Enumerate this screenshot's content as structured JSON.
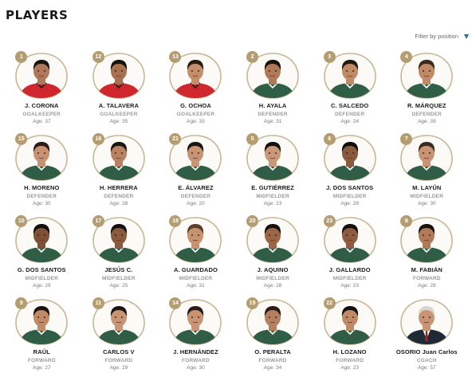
{
  "page": {
    "title": "Players"
  },
  "filter": {
    "label": "Filter by position"
  },
  "age_label": "Age:",
  "colors": {
    "frame_gold": "#c7b795",
    "badge_gold": "#b59d72",
    "jersey_green": "#2f5d46",
    "filter_caret": "#2c6aa5"
  },
  "players": [
    {
      "number": "1",
      "name": "J. CORONA",
      "position": "GOALKEEPER",
      "age": "37",
      "jersey": "#d0262e",
      "skin": "#b0785a",
      "hair": "#1b1410"
    },
    {
      "number": "12",
      "name": "A. TALAVERA",
      "position": "GOALKEEPER",
      "age": "35",
      "jersey": "#d0262e",
      "skin": "#a8704f",
      "hair": "#161210"
    },
    {
      "number": "13",
      "name": "G. OCHOA",
      "position": "GOALKEEPER",
      "age": "33",
      "jersey": "#d0262e",
      "skin": "#c58e6a",
      "hair": "#2a1a12"
    },
    {
      "number": "2",
      "name": "H. AYALA",
      "position": "DEFENDER",
      "age": "31",
      "jersey": "#2f5d46",
      "skin": "#b07a58",
      "hair": "#161210"
    },
    {
      "number": "3",
      "name": "C. SALCEDO",
      "position": "DEFENDER",
      "age": "24",
      "jersey": "#2f5d46",
      "skin": "#c08a66",
      "hair": "#231710"
    },
    {
      "number": "4",
      "name": "R. MÁRQUEZ",
      "position": "DEFENDER",
      "age": "39",
      "jersey": "#2f5d46",
      "skin": "#c08a66",
      "hair": "#3b2a20"
    },
    {
      "number": "15",
      "name": "H. MORENO",
      "position": "DEFENDER",
      "age": "30",
      "jersey": "#2f5d46",
      "skin": "#c69272",
      "hair": "#2a1c14"
    },
    {
      "number": "16",
      "name": "H. HERRERA",
      "position": "DEFENDER",
      "age": "28",
      "jersey": "#2f5d46",
      "skin": "#b98262",
      "hair": "#1e1510"
    },
    {
      "number": "21",
      "name": "E. ÁLVAREZ",
      "position": "DEFENDER",
      "age": "20",
      "jersey": "#2f5d46",
      "skin": "#c89474",
      "hair": "#1c1410"
    },
    {
      "number": "5",
      "name": "E. GUTIÉRREZ",
      "position": "MIDFIELDER",
      "age": "23",
      "jersey": "#2f5d46",
      "skin": "#c89878",
      "hair": "#141010"
    },
    {
      "number": "6",
      "name": "J. DOS SANTOS",
      "position": "MIDFIELDER",
      "age": "28",
      "jersey": "#2f5d46",
      "skin": "#8a5a3c",
      "hair": "#120e0c"
    },
    {
      "number": "7",
      "name": "M. LAYÚN",
      "position": "MIDFIELDER",
      "age": "30",
      "jersey": "#2f5d46",
      "skin": "#c89474",
      "hair": "#3a2a20"
    },
    {
      "number": "10",
      "name": "G. DOS SANTOS",
      "position": "MIDFIELDER",
      "age": "29",
      "jersey": "#2f5d46",
      "skin": "#7e5036",
      "hair": "#120e0c"
    },
    {
      "number": "17",
      "name": "JESÚS C.",
      "position": "MIDFIELDER",
      "age": "25",
      "jersey": "#2f5d46",
      "skin": "#8a5a3e",
      "hair": "#141010"
    },
    {
      "number": "18",
      "name": "A. GUARDADO",
      "position": "MIDFIELDER",
      "age": "31",
      "jersey": "#2f5d46",
      "skin": "#c69272",
      "hair": "#5a4028"
    },
    {
      "number": "20",
      "name": "J. AQUINO",
      "position": "MIDFIELDER",
      "age": "28",
      "jersey": "#2f5d46",
      "skin": "#9a6646",
      "hair": "#141010"
    },
    {
      "number": "23",
      "name": "J. GALLARDO",
      "position": "MIDFIELDER",
      "age": "23",
      "jersey": "#2f5d46",
      "skin": "#8e5c40",
      "hair": "#141010"
    },
    {
      "number": "8",
      "name": "M. FABIÁN",
      "position": "FORWARD",
      "age": "29",
      "jersey": "#2f5d46",
      "skin": "#b07a58",
      "hair": "#161210"
    },
    {
      "number": "9",
      "name": "RAÚL",
      "position": "FORWARD",
      "age": "27",
      "jersey": "#2f5d46",
      "skin": "#c08a66",
      "hair": "#1c1410"
    },
    {
      "number": "11",
      "name": "CARLOS V",
      "position": "FORWARD",
      "age": "29",
      "jersey": "#2f5d46",
      "skin": "#c89474",
      "hair": "#1c1410"
    },
    {
      "number": "14",
      "name": "J. HERNÁNDEZ",
      "position": "FORWARD",
      "age": "30",
      "jersey": "#2f5d46",
      "skin": "#c89474",
      "hair": "#2a1c14"
    },
    {
      "number": "19",
      "name": "O. PERALTA",
      "position": "FORWARD",
      "age": "34",
      "jersey": "#2f5d46",
      "skin": "#b58060",
      "hair": "#2a1c14"
    },
    {
      "number": "22",
      "name": "H. LOZANO",
      "position": "FORWARD",
      "age": "23",
      "jersey": "#2f5d46",
      "skin": "#c08a66",
      "hair": "#141010"
    },
    {
      "number": "",
      "name": "OSORIO Juan Carlos",
      "position": "COACH",
      "age": "57",
      "jersey": "#1e2a36",
      "skin": "#c89474",
      "hair": "#d8d4cc",
      "coach": true
    }
  ]
}
